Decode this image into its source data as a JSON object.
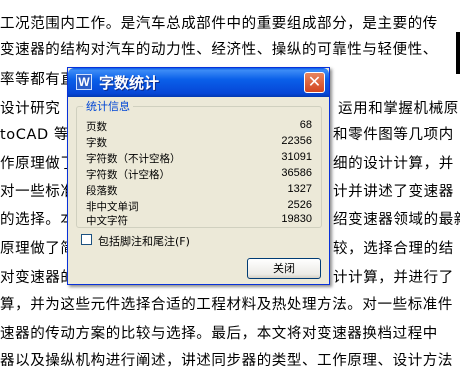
{
  "document": {
    "lines": [
      "工况范围内工作。是汽车总成部件中的重要组成部分，是主要的传",
      "变速器的结构对汽车的动力性、经济性、操纵的可靠性与轻便性、",
      "率等都有直",
      "设计研究",
      "运用和掌握机械原",
      "toCAD 等软",
      "和零件图等几项内",
      "作原理做了",
      "细的设计计算，并",
      "对一些标准",
      "计并讲述了变速器",
      "的选择。本文",
      "绍变速器领域的最新",
      "原理做了简",
      "较，选择合理的结",
      "对变速器的",
      "计计算，并进行了",
      "算，并为这些元件选择合适的工程材料及热处理方法。对一些标准件",
      "速器的传动方案的比较与选择。最后，本文将对变速器换档过程中",
      "器以及操纵机构进行阐述，讲述同步器的类型、工作原理、设计方法"
    ]
  },
  "dialog": {
    "title": "字数统计",
    "icon_letter": "W",
    "close_glyph": "✕",
    "group_title": "统计信息",
    "stats": [
      {
        "label": "页数",
        "value": "68"
      },
      {
        "label": "字数",
        "value": "22356"
      },
      {
        "label": "字符数（不计空格）",
        "value": "31091"
      },
      {
        "label": "字符数（计空格）",
        "value": "36586"
      },
      {
        "label": "段落数",
        "value": "1327"
      },
      {
        "label": "非中文单词",
        "value": "2526"
      },
      {
        "label": "中文字符",
        "value": "19830"
      }
    ],
    "checkbox_label": "包括脚注和尾注(F)",
    "checkbox_checked": false,
    "close_button_label": "关闭"
  }
}
